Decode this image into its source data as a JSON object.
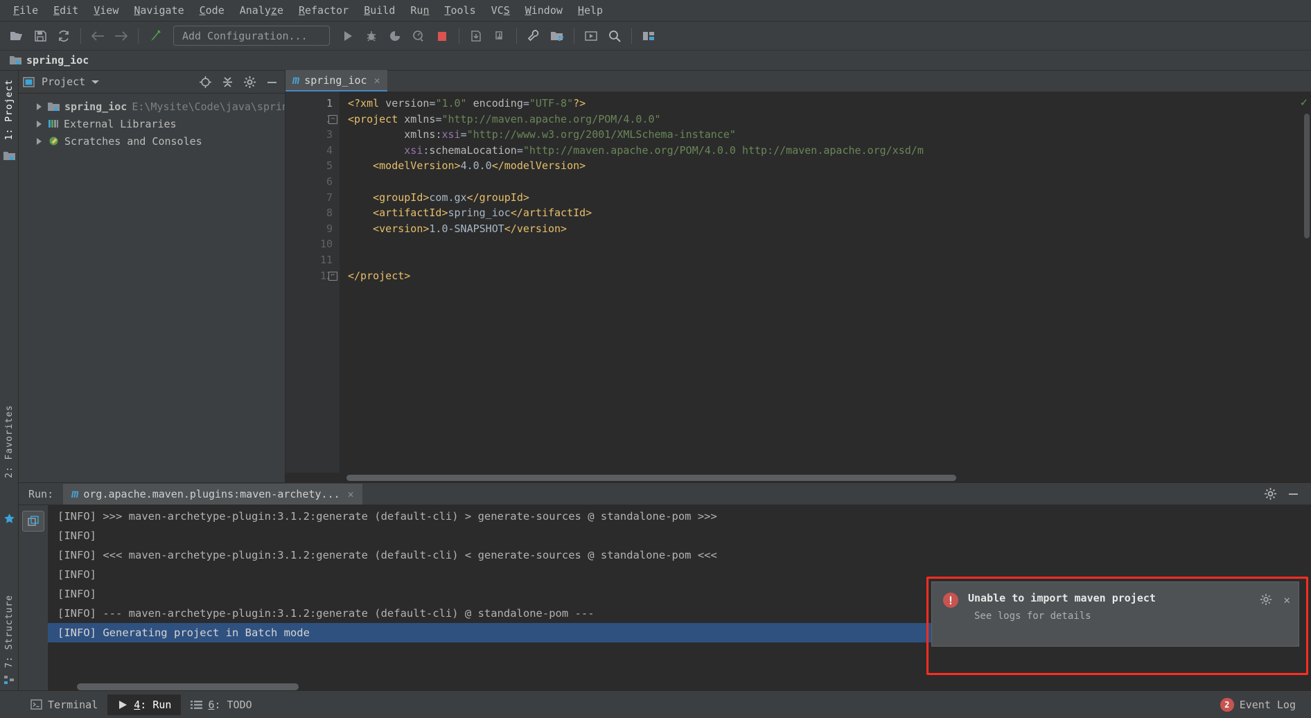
{
  "menubar": {
    "items": [
      {
        "label": "File",
        "mnemonic": "F"
      },
      {
        "label": "Edit",
        "mnemonic": "E"
      },
      {
        "label": "View",
        "mnemonic": "V"
      },
      {
        "label": "Navigate",
        "mnemonic": "N"
      },
      {
        "label": "Code",
        "mnemonic": "C"
      },
      {
        "label": "Analyze",
        "mnemonic": "z"
      },
      {
        "label": "Refactor",
        "mnemonic": "R"
      },
      {
        "label": "Build",
        "mnemonic": "B"
      },
      {
        "label": "Run",
        "mnemonic": "n"
      },
      {
        "label": "Tools",
        "mnemonic": "T"
      },
      {
        "label": "VCS",
        "mnemonic": "S"
      },
      {
        "label": "Window",
        "mnemonic": "W"
      },
      {
        "label": "Help",
        "mnemonic": "H"
      }
    ]
  },
  "toolbar": {
    "open_icon": "open-folder-icon",
    "save_icon": "save-icon",
    "sync_icon": "sync-icon",
    "back_icon": "navigate-back-icon",
    "forward_icon": "navigate-forward-icon",
    "build_icon": "build-hammer-icon",
    "run_config_label": "Add Configuration...",
    "run_icon": "run-icon",
    "debug_icon": "debug-icon",
    "coverage_icon": "run-with-coverage-icon",
    "profile_icon": "profile-icon",
    "stop_icon": "stop-icon",
    "update_project_icon": "update-project-icon",
    "commit_icon": "commit-icon",
    "settings_icon": "settings-wrench-icon",
    "project_structure_icon": "project-structure-icon",
    "presentation_icon": "presentation-icon",
    "search_icon": "search-everywhere-icon",
    "layout_icon": "layout-icon"
  },
  "navbar": {
    "project_icon": "module-folder-icon",
    "crumb": "spring_ioc"
  },
  "left_strip": {
    "project_label": "1: Project",
    "structure_label": "7: Structure",
    "favorites_label": "2: Favorites",
    "project_tool_icon": "project-tool-icon",
    "star_icon": "favorites-star-icon",
    "structure_icon": "structure-icon"
  },
  "project_panel": {
    "view_icon": "project-view-icon",
    "title": "Project",
    "dropdown_icon": "chevron-down-icon",
    "locate_icon": "scroll-from-source-icon",
    "collapse_icon": "collapse-all-icon",
    "gear_icon": "gear-icon",
    "minimize_icon": "minimize-icon",
    "tree": [
      {
        "label": "spring_ioc",
        "path": "E:\\Mysite\\Code\\java\\sprin",
        "icon": "module-folder-icon",
        "bold": true
      },
      {
        "label": "External Libraries",
        "path": "",
        "icon": "libraries-icon",
        "bold": false
      },
      {
        "label": "Scratches and Consoles",
        "path": "",
        "icon": "scratches-icon",
        "bold": false
      }
    ]
  },
  "editor": {
    "tab": {
      "label": "spring_ioc",
      "icon": "maven-m-icon",
      "close_icon": "close-icon"
    },
    "inspection_status_icon": "inspection-ok-icon",
    "lines": [
      {
        "num": "1",
        "segments": [
          {
            "t": "<?xml ",
            "c": "t-pi"
          },
          {
            "t": "version",
            "c": "t-attr"
          },
          {
            "t": "=",
            "c": "t-txt"
          },
          {
            "t": "\"1.0\"",
            "c": "t-str"
          },
          {
            "t": " encoding",
            "c": "t-attr"
          },
          {
            "t": "=",
            "c": "t-txt"
          },
          {
            "t": "\"UTF-8\"",
            "c": "t-str"
          },
          {
            "t": "?>",
            "c": "t-pi"
          }
        ]
      },
      {
        "num": "2",
        "fold": "collapse",
        "segments": [
          {
            "t": "<project",
            "c": "t-tag"
          },
          {
            "t": " xmlns",
            "c": "t-attr"
          },
          {
            "t": "=",
            "c": "t-txt"
          },
          {
            "t": "\"http://maven.apache.org/POM/4.0.0\"",
            "c": "t-str"
          }
        ]
      },
      {
        "num": "3",
        "segments": [
          {
            "t": "         xmlns",
            "c": "t-attr"
          },
          {
            "t": ":",
            "c": "t-txt"
          },
          {
            "t": "xsi",
            "c": "t-ns"
          },
          {
            "t": "=",
            "c": "t-txt"
          },
          {
            "t": "\"http://www.w3.org/2001/XMLSchema-instance\"",
            "c": "t-str"
          }
        ]
      },
      {
        "num": "4",
        "segments": [
          {
            "t": "         ",
            "c": "t-txt"
          },
          {
            "t": "xsi",
            "c": "t-ns"
          },
          {
            "t": ":",
            "c": "t-txt"
          },
          {
            "t": "schemaLocation",
            "c": "t-attr"
          },
          {
            "t": "=",
            "c": "t-txt"
          },
          {
            "t": "\"http://maven.apache.org/POM/4.0.0 http://maven.apache.org/xsd/m",
            "c": "t-str"
          }
        ]
      },
      {
        "num": "5",
        "segments": [
          {
            "t": "    <modelVersion>",
            "c": "t-tag"
          },
          {
            "t": "4.0.0",
            "c": "t-txt"
          },
          {
            "t": "</modelVersion>",
            "c": "t-tag"
          }
        ]
      },
      {
        "num": "6",
        "segments": [
          {
            "t": "",
            "c": "t-txt"
          }
        ]
      },
      {
        "num": "7",
        "segments": [
          {
            "t": "    <groupId>",
            "c": "t-tag"
          },
          {
            "t": "com.gx",
            "c": "t-txt"
          },
          {
            "t": "</groupId>",
            "c": "t-tag"
          }
        ]
      },
      {
        "num": "8",
        "segments": [
          {
            "t": "    <artifactId>",
            "c": "t-tag"
          },
          {
            "t": "spring_ioc",
            "c": "t-txt"
          },
          {
            "t": "</artifactId>",
            "c": "t-tag"
          }
        ]
      },
      {
        "num": "9",
        "segments": [
          {
            "t": "    <version>",
            "c": "t-tag"
          },
          {
            "t": "1.0-SNAPSHOT",
            "c": "t-txt"
          },
          {
            "t": "</version>",
            "c": "t-tag"
          }
        ]
      },
      {
        "num": "10",
        "segments": [
          {
            "t": "",
            "c": "t-txt"
          }
        ]
      },
      {
        "num": "11",
        "segments": [
          {
            "t": "",
            "c": "t-txt"
          }
        ]
      },
      {
        "num": "12",
        "fold": "end",
        "segments": [
          {
            "t": "</project>",
            "c": "t-tag"
          }
        ]
      }
    ]
  },
  "run_panel": {
    "run_label": "Run:",
    "tab_label": "org.apache.maven.plugins:maven-archety...",
    "tab_icon": "maven-m-icon",
    "tab_close_icon": "close-icon",
    "gear_icon": "gear-icon",
    "minimize_icon": "minimize-icon",
    "rerun_icon": "rerun-icon",
    "toggle_icon": "toggle-tasks-icon",
    "console_lines": [
      {
        "text": "[INFO] >>> maven-archetype-plugin:3.1.2:generate (default-cli) > generate-sources @ standalone-pom >>>",
        "selected": false
      },
      {
        "text": "[INFO]",
        "selected": false
      },
      {
        "text": "[INFO] <<< maven-archetype-plugin:3.1.2:generate (default-cli) < generate-sources @ standalone-pom <<<",
        "selected": false
      },
      {
        "text": "[INFO]",
        "selected": false
      },
      {
        "text": "[INFO]",
        "selected": false
      },
      {
        "text": "[INFO] --- maven-archetype-plugin:3.1.2:generate (default-cli) @ standalone-pom ---",
        "selected": false
      },
      {
        "text": "[INFO] Generating project in Batch mode",
        "selected": true
      }
    ]
  },
  "notification": {
    "error_icon": "error-circle-icon",
    "title": "Unable to import maven project",
    "subtitle": "See logs for details",
    "gear_icon": "gear-icon",
    "close_icon": "close-icon",
    "outline_color": "#ff2d21"
  },
  "statusbar": {
    "items": [
      {
        "label": "Terminal",
        "mnemonic": "",
        "icon": "terminal-icon",
        "active": false
      },
      {
        "label": "4: Run",
        "mnemonic": "4",
        "icon": "run-icon",
        "active": true
      },
      {
        "label": "6: TODO",
        "mnemonic": "6",
        "icon": "todo-list-icon",
        "active": false
      }
    ],
    "event_log_label": "Event Log",
    "event_log_count": "2"
  },
  "colors": {
    "accent_blue": "#4a88c7",
    "selection_blue": "#2f5180",
    "error_red": "#c75450",
    "string_green": "#6a8759",
    "tag_gold": "#e8bf6a",
    "ns_purple": "#9876aa",
    "panel_bg": "#3c3f41",
    "editor_bg": "#2b2b2b"
  }
}
